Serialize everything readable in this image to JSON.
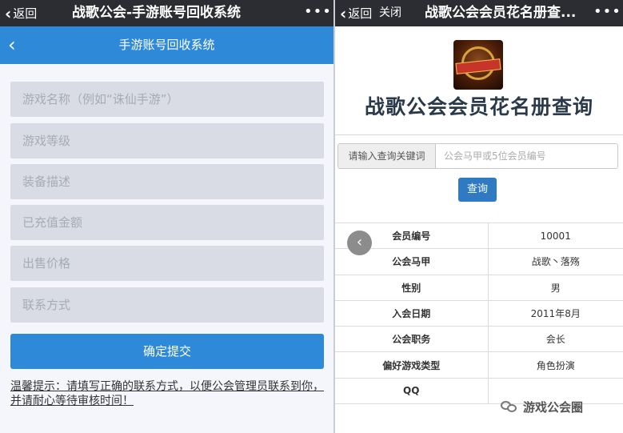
{
  "left": {
    "topbar": {
      "back_label": "返回",
      "title": "战歌公会-手游账号回收系统",
      "more_label": "•••"
    },
    "header": {
      "back_glyph": "‹",
      "title": "手游账号回收系统"
    },
    "form": {
      "fields": [
        {
          "placeholder": "游戏名称（例如“诛仙手游”）"
        },
        {
          "placeholder": "游戏等级"
        },
        {
          "placeholder": "装备描述"
        },
        {
          "placeholder": "已充值金额"
        },
        {
          "placeholder": "出售价格"
        },
        {
          "placeholder": "联系方式"
        }
      ],
      "submit_label": "确定提交",
      "tip": "温馨提示：请填写正确的联系方式，以便公会管理员联系到你，并请耐心等待审核时间！"
    }
  },
  "right": {
    "topbar": {
      "back_label": "返回",
      "close_label": "关闭",
      "title": "战歌公会会员花名册查...",
      "more_label": "•••"
    },
    "logo_icon": "guild-logo-image",
    "page_title": "战歌公会会员花名册查询",
    "search": {
      "addon_label": "请输入查询关键词",
      "placeholder": "公会马甲或5位会员编号",
      "button_label": "查询"
    },
    "table": {
      "rows": [
        {
          "key": "会员编号",
          "value": "10001"
        },
        {
          "key": "公会马甲",
          "value": "战歌丶落殇"
        },
        {
          "key": "性别",
          "value": "男"
        },
        {
          "key": "入会日期",
          "value": "2011年8月"
        },
        {
          "key": "公会职务",
          "value": "会长"
        },
        {
          "key": "偏好游戏类型",
          "value": "角色扮演"
        },
        {
          "key": "QQ",
          "value": ""
        }
      ]
    },
    "float_back_glyph": "‹",
    "watermark": "游戏公会圈"
  },
  "colors": {
    "wechat_bar": "#2b2d33",
    "accent_blue": "#2e8ad8",
    "button_blue": "#2e7bc4",
    "field_bg": "#d9dce4"
  }
}
